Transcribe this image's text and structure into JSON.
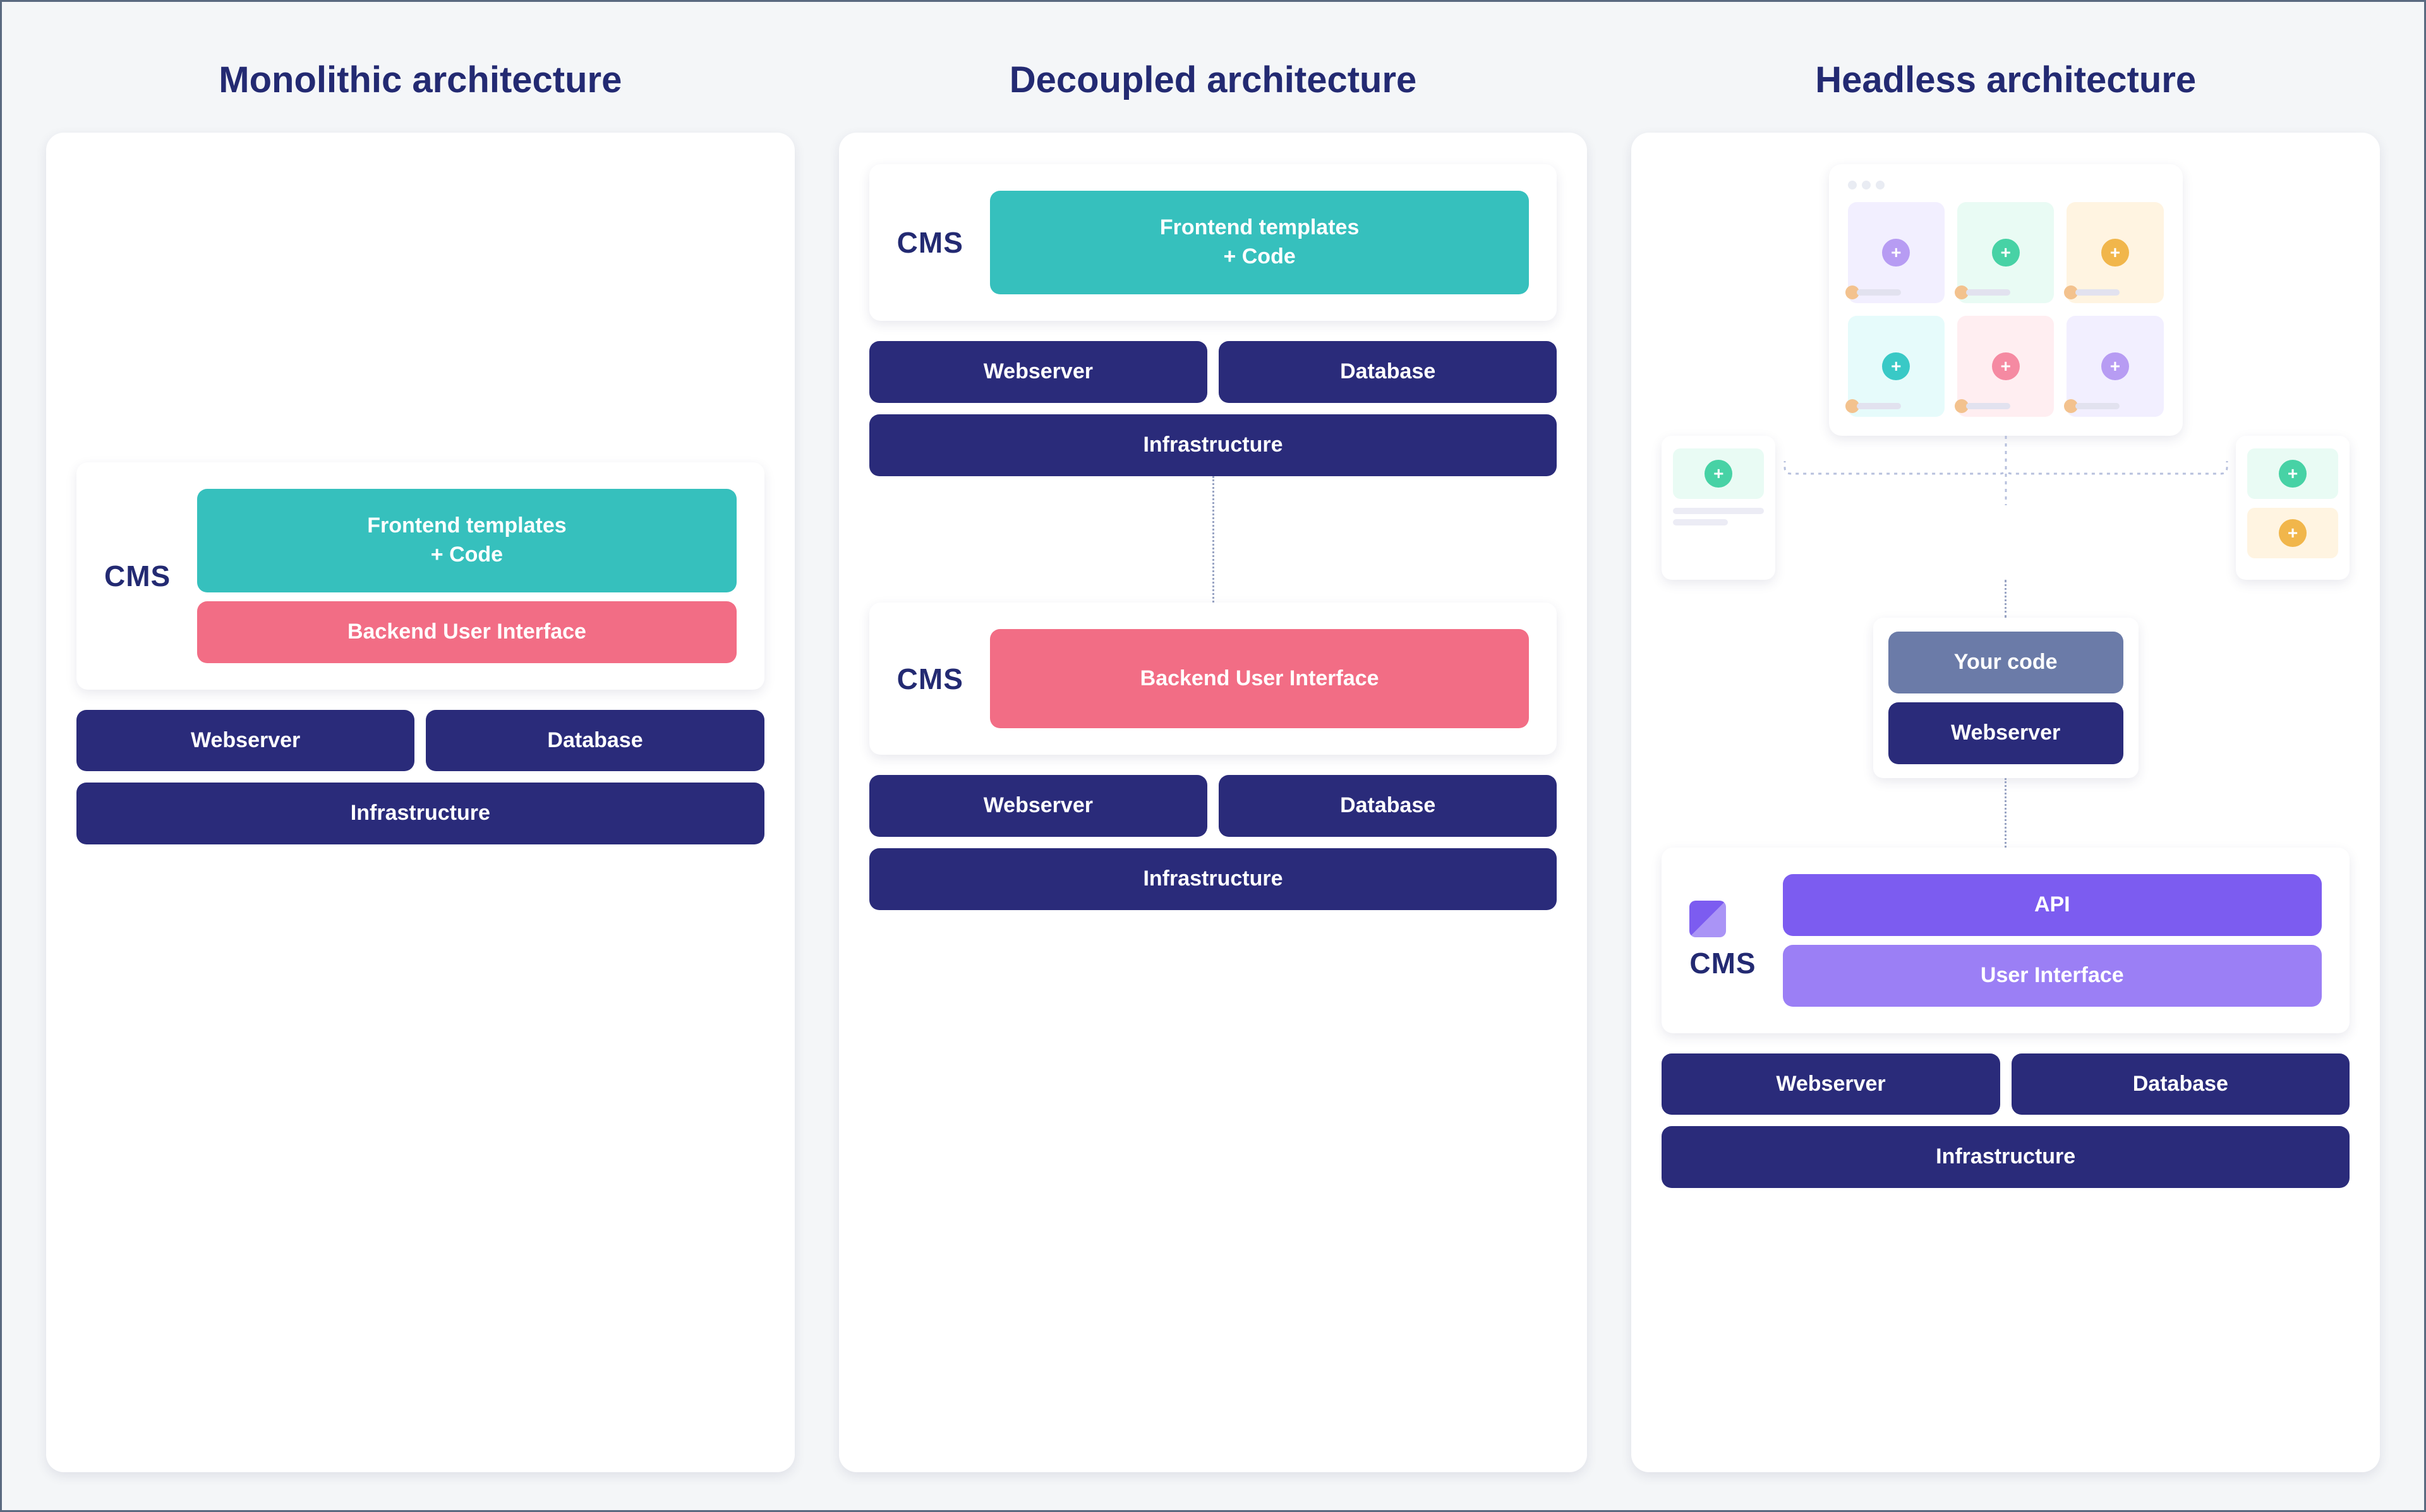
{
  "colors": {
    "navy": "#2a2b7a",
    "teal": "#36c0bd",
    "pink": "#f26d85",
    "purple": "#7c5cf0",
    "purple_light": "#9b7ff5",
    "slate": "#6b7ba8"
  },
  "labels": {
    "cms": "CMS",
    "frontend": "Frontend templates\n+ Code",
    "backend_ui": "Backend User Interface",
    "webserver": "Webserver",
    "database": "Database",
    "infrastructure": "Infrastructure",
    "your_code": "Your code",
    "api": "API",
    "user_interface": "User Interface"
  },
  "columns": {
    "monolithic": {
      "title": "Monolithic architecture"
    },
    "decoupled": {
      "title": "Decoupled architecture"
    },
    "headless": {
      "title": "Headless architecture"
    }
  }
}
